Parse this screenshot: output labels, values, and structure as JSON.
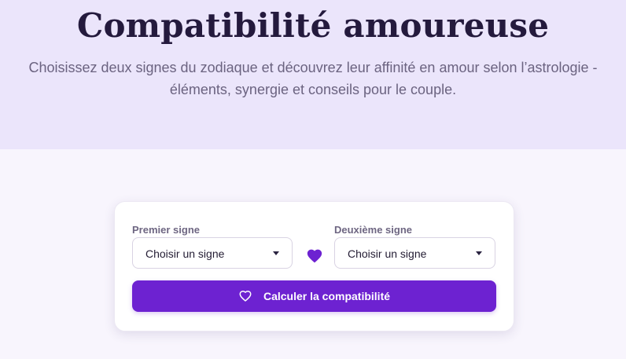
{
  "hero": {
    "title": "Compatibilité amoureuse",
    "subtitle_line1": "Choisissez deux signes du zodiaque et découvrez leur affinité en amour selon l’astrologie -",
    "subtitle_line2": "éléments, synergie et conseils pour le couple."
  },
  "form": {
    "first_sign": {
      "label": "Premier signe",
      "value": "Choisir un signe"
    },
    "second_sign": {
      "label": "Deuxième signe",
      "value": "Choisir un signe"
    },
    "separator_icon": "heart-icon",
    "submit": {
      "icon": "heart-outline-icon",
      "label": "Calculer la compatibilité"
    }
  },
  "colors": {
    "hero_background": "#ebe5fb",
    "page_background": "#f8f5fd",
    "accent": "#6d22d1",
    "heart": "#6d22d1"
  }
}
